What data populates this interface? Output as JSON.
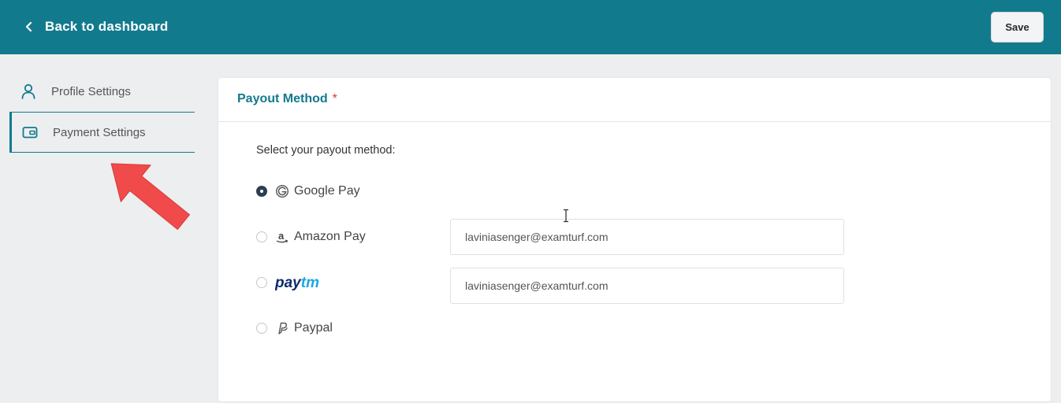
{
  "header": {
    "back_label": "Back to dashboard",
    "save_label": "Save"
  },
  "sidebar": {
    "items": [
      {
        "label": "Profile Settings",
        "icon": "user-icon",
        "active": false
      },
      {
        "label": "Payment Settings",
        "icon": "wallet-icon",
        "active": true
      }
    ]
  },
  "card": {
    "title": "Payout Method",
    "required_mark": "*",
    "prompt": "Select your payout method:",
    "options": [
      {
        "label": "Google Pay",
        "icon": "google-icon",
        "selected": true
      },
      {
        "label": "Amazon Pay",
        "icon": "amazon-icon",
        "selected": false,
        "field_value": "laviniasenger@examturf.com"
      },
      {
        "label": "paytm",
        "icon": "paytm-logo",
        "selected": false,
        "field_value": "laviniasenger@examturf.com"
      },
      {
        "label": "Paypal",
        "icon": "paypal-icon",
        "selected": false
      }
    ]
  },
  "colors": {
    "brand": "#127a8d",
    "required": "#d9363e",
    "arrow": "#f04a4a"
  }
}
